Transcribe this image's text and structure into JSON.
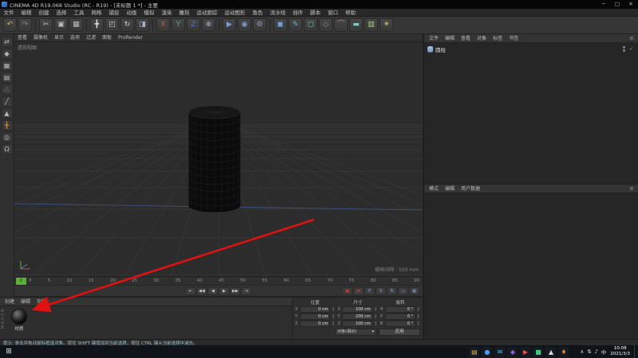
{
  "window": {
    "title": "CINEMA 4D R19.068 Studio (RC - R19) - [未标题 1 *] - 主要",
    "minimize": "─",
    "maximize": "□",
    "close": "✕"
  },
  "menubar": {
    "items": [
      "文件",
      "编辑",
      "创建",
      "选择",
      "工具",
      "网格",
      "捕捉",
      "动画",
      "模拟",
      "渲染",
      "雕刻",
      "运动跟踪",
      "运动图形",
      "角色",
      "流水线",
      "插件",
      "脚本",
      "窗口",
      "帮助"
    ]
  },
  "toolbar": {
    "icons": [
      {
        "name": "undo",
        "glyph": "↶",
        "color": "#d9b13f"
      },
      {
        "name": "redo",
        "glyph": "↷",
        "color": "#8a8a8a"
      },
      {
        "name": "separator",
        "glyph": "",
        "color": ""
      },
      {
        "name": "cut",
        "glyph": "✂",
        "color": "#bdbdbd"
      },
      {
        "name": "copy",
        "glyph": "▣",
        "color": "#bdbdbd"
      },
      {
        "name": "paste",
        "glyph": "▦",
        "color": "#bdbdbd"
      },
      {
        "name": "separator",
        "glyph": "",
        "color": ""
      },
      {
        "name": "move",
        "glyph": "╋",
        "color": "#e8e8e8"
      },
      {
        "name": "scale",
        "glyph": "◰",
        "color": "#d0d0d0"
      },
      {
        "name": "rotate",
        "glyph": "↻",
        "color": "#d0d0d0"
      },
      {
        "name": "last-tool",
        "glyph": "◨",
        "color": "#9fb7d0"
      },
      {
        "name": "separator",
        "glyph": "",
        "color": ""
      },
      {
        "name": "lock-x-axis",
        "glyph": "X",
        "color": "#c25656"
      },
      {
        "name": "lock-y-axis",
        "glyph": "Y",
        "color": "#5ca85c"
      },
      {
        "name": "lock-z-axis",
        "glyph": "Z",
        "color": "#5c74c2"
      },
      {
        "name": "coordinate-system",
        "glyph": "⊕",
        "color": "#9fb7d0"
      },
      {
        "name": "separator",
        "glyph": "",
        "color": ""
      },
      {
        "name": "render-view",
        "glyph": "▶",
        "color": "#7f9fd8"
      },
      {
        "name": "render-picture-viewer",
        "glyph": "◉",
        "color": "#7f9fd8"
      },
      {
        "name": "render-settings",
        "glyph": "⚙",
        "color": "#7f9fd8"
      },
      {
        "name": "separator",
        "glyph": "",
        "color": ""
      },
      {
        "name": "add-cube",
        "glyph": "◼",
        "color": "#6f9fd8"
      },
      {
        "name": "add-spline",
        "glyph": "✎",
        "color": "#5fb8d8"
      },
      {
        "name": "add-subdivision-surface",
        "glyph": "◻",
        "color": "#5fd89f"
      },
      {
        "name": "add-array",
        "glyph": "◇",
        "color": "#b06fd8"
      },
      {
        "name": "add-deformer",
        "glyph": "⌒",
        "color": "#d86fb8"
      },
      {
        "name": "add-floor",
        "glyph": "▬",
        "color": "#5fd8c8"
      },
      {
        "name": "add-camera",
        "glyph": "▥",
        "color": "#9fd85f"
      },
      {
        "name": "add-light",
        "glyph": "☀",
        "color": "#d8d05f"
      }
    ]
  },
  "left_palette": {
    "icons": [
      {
        "name": "make-editable",
        "glyph": "⇄",
        "color": "#b8b8b8"
      },
      {
        "name": "model-mode",
        "glyph": "◆",
        "color": "#b8b8b8"
      },
      {
        "name": "texture-mode",
        "glyph": "▦",
        "color": "#b8b8b8"
      },
      {
        "name": "workplane-mode",
        "glyph": "▤",
        "color": "#b8b8b8"
      },
      {
        "name": "points-mode",
        "glyph": "∴",
        "color": "#b8b8b8"
      },
      {
        "name": "edges-mode",
        "glyph": "╱",
        "color": "#b8b8b8"
      },
      {
        "name": "polygons-mode",
        "glyph": "▲",
        "color": "#b8b8b8"
      },
      {
        "name": "enable-axis",
        "glyph": "╋",
        "color": "#c8893f"
      },
      {
        "name": "viewport-solo",
        "glyph": "◎",
        "color": "#b8b8b8"
      },
      {
        "name": "enable-snap",
        "glyph": "Ω",
        "color": "#b8b8b8"
      }
    ]
  },
  "viewport": {
    "menus": [
      "查看",
      "摄像机",
      "显示",
      "选项",
      "过滤",
      "面板",
      "ProRender"
    ],
    "hud_top_left": "透视视图",
    "hud_bottom_right": "栅格间隔 : 500 mm"
  },
  "object_manager": {
    "tabs": [
      "文件",
      "编辑",
      "查看",
      "对象",
      "标签",
      "书签"
    ],
    "objects": [
      {
        "name": "圆柱",
        "state": "✓"
      }
    ]
  },
  "attribute_manager": {
    "tabs": [
      "模式",
      "编辑",
      "用户数据"
    ],
    "menu_icon": "≡"
  },
  "material_manager": {
    "tabs": [
      "创建",
      "编辑",
      "功能"
    ],
    "materials": [
      {
        "name": "材质"
      }
    ]
  },
  "coordinates": {
    "columns": [
      {
        "label": "位置",
        "rows": [
          {
            "k": "X",
            "v": "0 cm"
          },
          {
            "k": "Y",
            "v": "0 cm"
          },
          {
            "k": "Z",
            "v": "0 cm"
          }
        ]
      },
      {
        "label": "尺寸",
        "rows": [
          {
            "k": "X",
            "v": "100 cm"
          },
          {
            "k": "Y",
            "v": "200 cm"
          },
          {
            "k": "Z",
            "v": "100 cm"
          }
        ]
      },
      {
        "label": "旋转",
        "rows": [
          {
            "k": "H",
            "v": "0 °"
          },
          {
            "k": "P",
            "v": "0 °"
          },
          {
            "k": "B",
            "v": "0 °"
          }
        ]
      }
    ],
    "mode_dropdown": "对象(相对)",
    "dropdown_arrow": "▾",
    "apply_button": "应用"
  },
  "timeline": {
    "start": 0,
    "end": 90,
    "step": 5,
    "current": "0"
  },
  "transport": {
    "buttons": [
      {
        "name": "goto-start",
        "glyph": "⇤"
      },
      {
        "name": "previous-key",
        "glyph": "◀◀"
      },
      {
        "name": "previous-frame",
        "glyph": "◀"
      },
      {
        "name": "play",
        "glyph": "▶"
      },
      {
        "name": "next-frame",
        "glyph": "▶▶"
      },
      {
        "name": "goto-end",
        "glyph": "⇥"
      }
    ],
    "record": [
      {
        "name": "record-keyframe",
        "glyph": "●",
        "color": "#c23b3b"
      },
      {
        "name": "autokey",
        "glyph": "◉",
        "color": "#c23b3b"
      },
      {
        "name": "record-position",
        "glyph": "P",
        "color": "#8fa9d8"
      },
      {
        "name": "record-scale",
        "glyph": "S",
        "color": "#8fa9d8"
      },
      {
        "name": "record-rotation",
        "glyph": "R",
        "color": "#8fa9d8"
      },
      {
        "name": "record-parameter",
        "glyph": "◇",
        "color": "#8fa9d8"
      },
      {
        "name": "record-pla",
        "glyph": "▦",
        "color": "#8fa9d8"
      }
    ]
  },
  "status_bar": {
    "text": "提示: 单击并拖动鼠标框选对象。按住 SHIFT 键增加到当前选择，按住 CTRL 键从当前选择中减去。"
  },
  "taskbar": {
    "start_glyph": "⊞",
    "apps": [
      {
        "name": "file-explorer",
        "glyph": "▤",
        "color": "#dcaf4a"
      },
      {
        "name": "browser",
        "glyph": "●",
        "color": "#4a9ff0"
      },
      {
        "name": "mail",
        "glyph": "✉",
        "color": "#46b8e8"
      },
      {
        "name": "app-4",
        "glyph": "◆",
        "color": "#8f5ae0"
      },
      {
        "name": "app-5",
        "glyph": "▶",
        "color": "#e05050"
      },
      {
        "name": "app-6",
        "glyph": "■",
        "color": "#46c87a"
      },
      {
        "name": "app-7",
        "glyph": "▲",
        "color": "#d8d8d8"
      },
      {
        "name": "app-8",
        "glyph": "♦",
        "color": "#e08a3a"
      }
    ],
    "tray": [
      {
        "name": "chevron-up",
        "glyph": "∧"
      },
      {
        "name": "network",
        "glyph": "⇅"
      },
      {
        "name": "volume",
        "glyph": "♪"
      },
      {
        "name": "ime-language",
        "glyph": "中"
      }
    ],
    "time": "10:08",
    "date": "2021/3/3"
  },
  "annotation": {
    "arrow_color": "#e01111"
  },
  "brand": {
    "vertical_label": "MAXON"
  }
}
